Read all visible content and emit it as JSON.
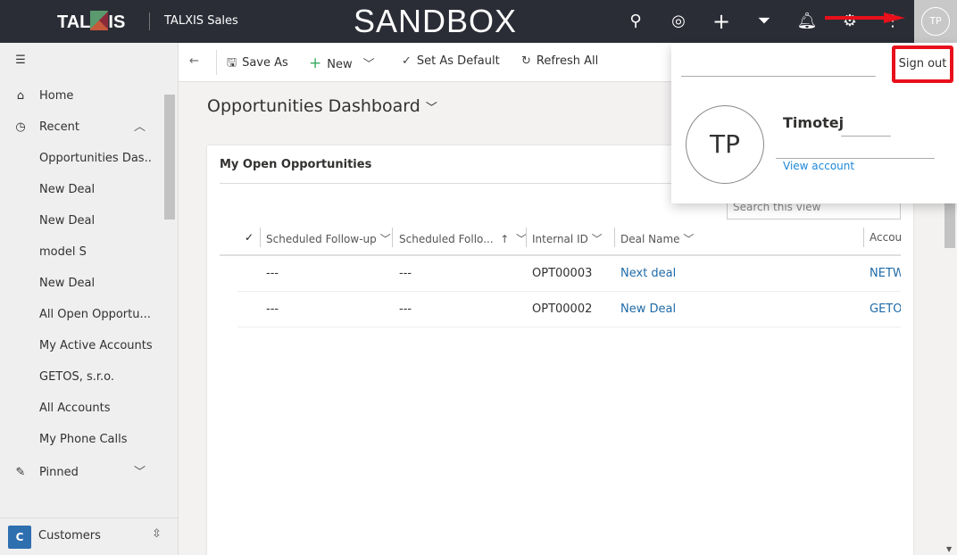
{
  "header": {
    "logo": "TALXIS",
    "app_name": "TALXIS Sales",
    "environment": "SANDBOX",
    "avatar_initials": "TP",
    "icons": [
      "search-icon",
      "target-icon",
      "plus-icon",
      "filter-icon",
      "bell-icon",
      "gear-icon",
      "more-icon"
    ]
  },
  "sidebar": {
    "home": "Home",
    "recent": "Recent",
    "recent_items": [
      "Opportunities Das...",
      "New Deal",
      "New Deal",
      "model S",
      "New Deal",
      "All Open Opportu...",
      "My Active Accounts",
      "GETOS, s.r.o.",
      "All Accounts",
      "My Phone Calls"
    ],
    "pinned": "Pinned",
    "area_badge": "C",
    "area": "Customers"
  },
  "toolbar": {
    "save_as": "Save As",
    "new": "New",
    "set_default": "Set As Default",
    "refresh": "Refresh All"
  },
  "main": {
    "title": "Opportunities Dashboard",
    "card": {
      "title": "My Open Opportunities",
      "search_placeholder": "Search this view",
      "columns": [
        "Scheduled Follow-up",
        "Scheduled Follo...",
        "Internal ID",
        "Deal Name",
        "Accou"
      ],
      "rows": [
        [
          "---",
          "---",
          "OPT00003",
          "Next deal",
          "NETW"
        ],
        [
          "---",
          "---",
          "OPT00002",
          "New Deal",
          "GETO"
        ]
      ]
    }
  },
  "profile_popup": {
    "sign_out": "Sign out",
    "initials": "TP",
    "name": "Timotej",
    "view_account": "View account"
  },
  "colors": {
    "header": "#2b2d36",
    "link": "#1e6aa8",
    "highlight": "#e8101a"
  }
}
